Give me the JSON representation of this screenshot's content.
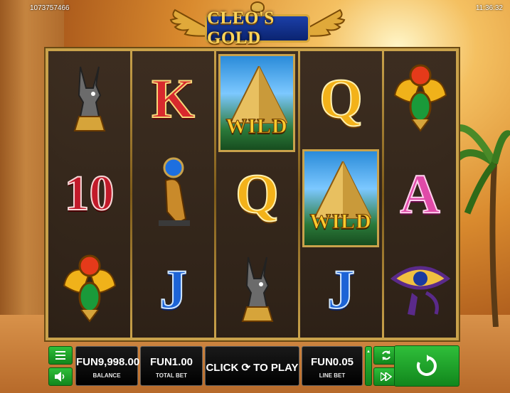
{
  "header": {
    "session_id": "1073757466",
    "clock": "11:36:32"
  },
  "logo": {
    "text": "CLEO'S GOLD"
  },
  "reels": {
    "symbols": [
      [
        "anubis",
        "10",
        "scarab"
      ],
      [
        "K",
        "falcon",
        "J"
      ],
      [
        "wild",
        "Q",
        "anubis"
      ],
      [
        "Q",
        "wild",
        "J"
      ],
      [
        "scarab",
        "A",
        "eye-of-horus"
      ]
    ],
    "wild_label": "WILD"
  },
  "letters": {
    "k": "K",
    "ten": "10",
    "q1": "Q",
    "q2": "Q",
    "j1": "J",
    "j2": "J",
    "a": "A"
  },
  "panel": {
    "balance_value": "FUN9,998.00",
    "balance_label": "BALANCE",
    "total_bet_value": "FUN1.00",
    "total_bet_label": "TOTAL BET",
    "play_text": "CLICK ⟳ TO PLAY",
    "line_bet_value": "FUN0.05",
    "line_bet_label": "LINE BET"
  },
  "icons": {
    "menu": "menu-icon",
    "sound": "speaker-icon",
    "autoplay": "autoplay-icon",
    "turbo": "fast-forward-icon",
    "spin": "spin-icon"
  },
  "colors": {
    "frame_gold": "#c9a24b",
    "button_green": "#2fbf3a",
    "panel_black": "#000000"
  }
}
